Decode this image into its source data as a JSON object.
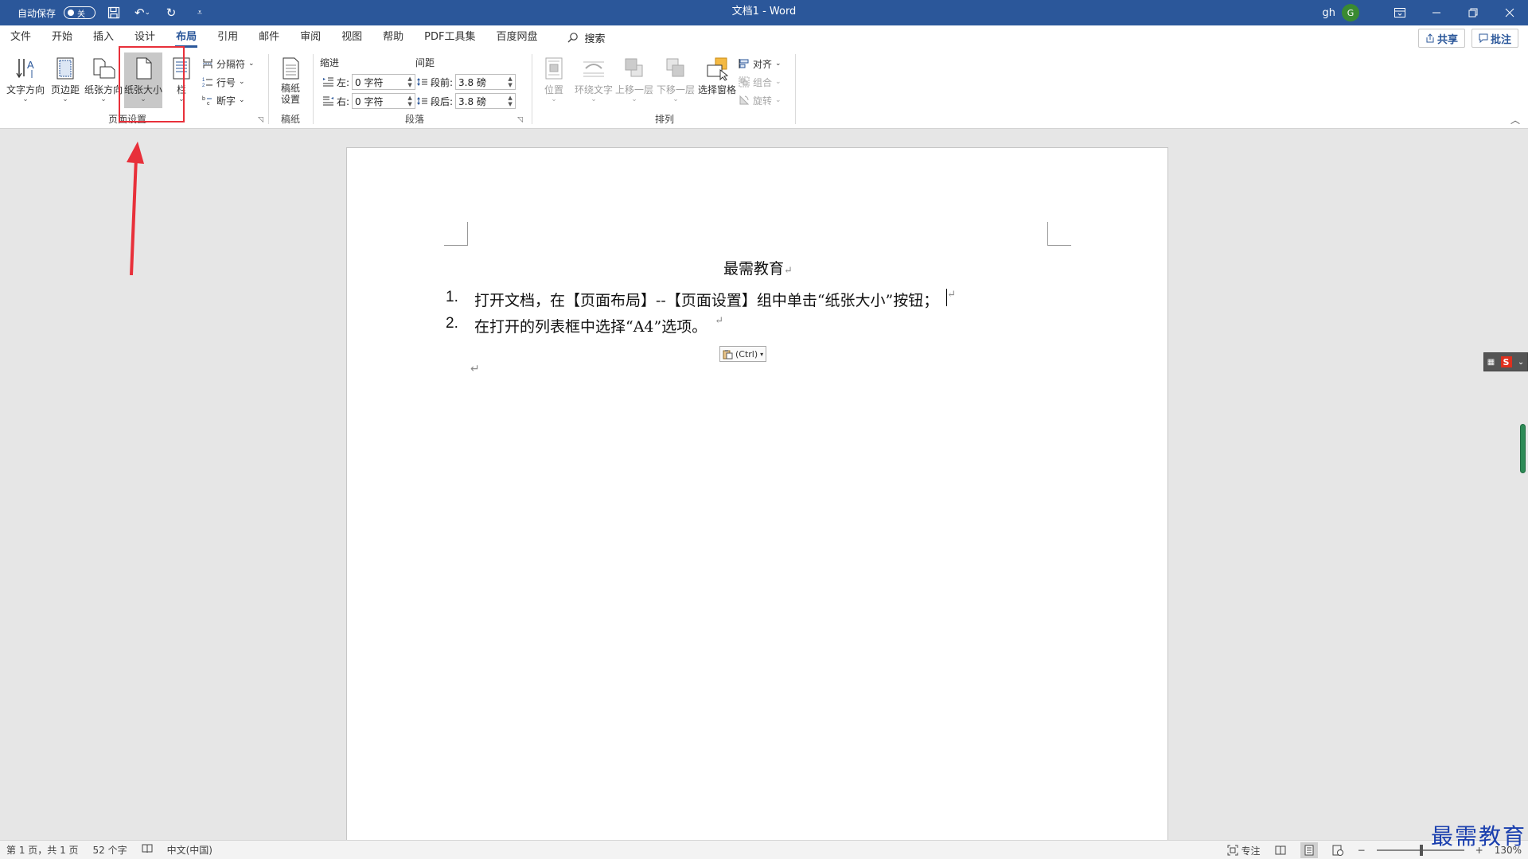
{
  "titlebar": {
    "autosave_label": "自动保存",
    "autosave_state": "关",
    "title": "文档1  -  Word",
    "user_name": "gh",
    "user_initial": "G"
  },
  "tabs": [
    "文件",
    "开始",
    "插入",
    "设计",
    "布局",
    "引用",
    "邮件",
    "审阅",
    "视图",
    "帮助",
    "PDF工具集",
    "百度网盘"
  ],
  "active_tab": "布局",
  "search_label": "搜索",
  "share_label": "共享",
  "comment_label": "批注",
  "ribbon": {
    "page_setup": {
      "label": "页面设置",
      "text_direction": "文字方向",
      "margins": "页边距",
      "orientation": "纸张方向",
      "size": "纸张大小",
      "columns": "栏",
      "breaks": "分隔符",
      "line_numbers": "行号",
      "hyphenation": "断字"
    },
    "manuscript": {
      "label": "稿纸",
      "settings_line1": "稿纸",
      "settings_line2": "设置"
    },
    "paragraph": {
      "label": "段落",
      "indent_label": "缩进",
      "spacing_label": "间距",
      "left_label": "左:",
      "right_label": "右:",
      "before_label": "段前:",
      "after_label": "段后:",
      "left_value": "0 字符",
      "right_value": "0 字符",
      "before_value": "3.8 磅",
      "after_value": "3.8 磅"
    },
    "arrange": {
      "label": "排列",
      "position": "位置",
      "wrap_text": "环绕文字",
      "bring_forward": "上移一层",
      "send_backward": "下移一层",
      "selection_pane": "选择窗格",
      "align": "对齐",
      "group": "组合",
      "rotate": "旋转"
    }
  },
  "document": {
    "title": "最需教育",
    "para_mark": "↵",
    "items": [
      {
        "num": "1.",
        "text": "打开文档，在【页面布局】--【页面设置】组中单击“纸张大小”按钮；"
      },
      {
        "num": "2.",
        "text": "在打开的列表框中选择“A4”选项。"
      }
    ],
    "paste_options": "(Ctrl)"
  },
  "statusbar": {
    "page": "第 1 页，共 1 页",
    "words": "52 个字",
    "language": "中文(中国)",
    "focus": "专注",
    "zoom": "130%"
  },
  "watermark": "最需教育",
  "colors": {
    "accent": "#2b579a",
    "highlight": "#e8303a"
  }
}
